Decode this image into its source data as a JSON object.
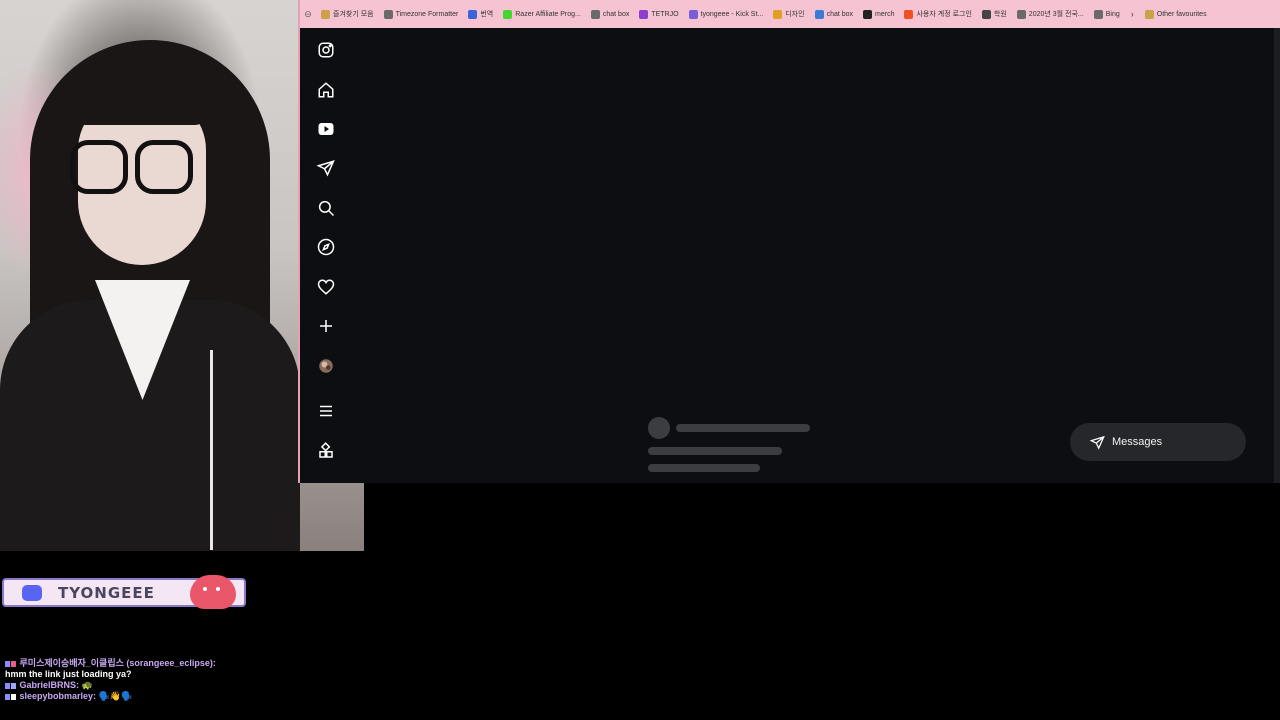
{
  "bookmarks": [
    {
      "label": "즐겨찾기 모음",
      "icon": "folder-icon",
      "color": "#c9a24a"
    },
    {
      "label": "Timezone Formatter",
      "icon": "globe-icon",
      "color": "#6a6a6a"
    },
    {
      "label": "번역",
      "icon": "translate-icon",
      "color": "#3a64d8"
    },
    {
      "label": "Razer Affiliate Prog...",
      "icon": "razer-icon",
      "color": "#44d62c"
    },
    {
      "label": "chat box",
      "icon": "globe-icon",
      "color": "#6a6a6a"
    },
    {
      "label": "TETRJO",
      "icon": "tetrio-icon",
      "color": "#8b3dd0"
    },
    {
      "label": "tyongeee - Kick St...",
      "icon": "kick-icon",
      "color": "#7a5cd6"
    },
    {
      "label": "디자인",
      "icon": "drive-icon",
      "color": "#e0a020"
    },
    {
      "label": "chat box",
      "icon": "globe-icon",
      "color": "#3a7bd5"
    },
    {
      "label": "merch",
      "icon": "fw-icon",
      "color": "#222222"
    },
    {
      "label": "사용자 계정 로그인",
      "icon": "microsoft-icon",
      "color": "#f25022"
    },
    {
      "label": "학원",
      "icon": "star-icon",
      "color": "#444444"
    },
    {
      "label": "2020년 3월 전국...",
      "icon": "globe-icon",
      "color": "#6a6a6a"
    },
    {
      "label": "Bing",
      "icon": "globe-icon",
      "color": "#6a6a6a"
    }
  ],
  "other_favourites": "Other favourites",
  "nav": [
    {
      "name": "instagram-icon"
    },
    {
      "name": "home-icon"
    },
    {
      "name": "reels-icon"
    },
    {
      "name": "send-icon"
    },
    {
      "name": "search-icon"
    },
    {
      "name": "explore-icon"
    },
    {
      "name": "heart-icon"
    },
    {
      "name": "create-icon"
    },
    {
      "name": "profile-avatar"
    },
    {
      "name": "menu-icon"
    },
    {
      "name": "apps-icon"
    }
  ],
  "messages_label": "Messages",
  "discord": {
    "name": "TYONGEEE"
  },
  "chat": [
    {
      "user": "루미스제이승배자_이클립스 (sorangeee_eclipse):",
      "message": "hmm the link just loading ya?"
    },
    {
      "user": "GabrielBRNS:",
      "message": "🐢"
    },
    {
      "user": "sleepybobmarley:",
      "message": "🗣️👋🗣️"
    }
  ]
}
